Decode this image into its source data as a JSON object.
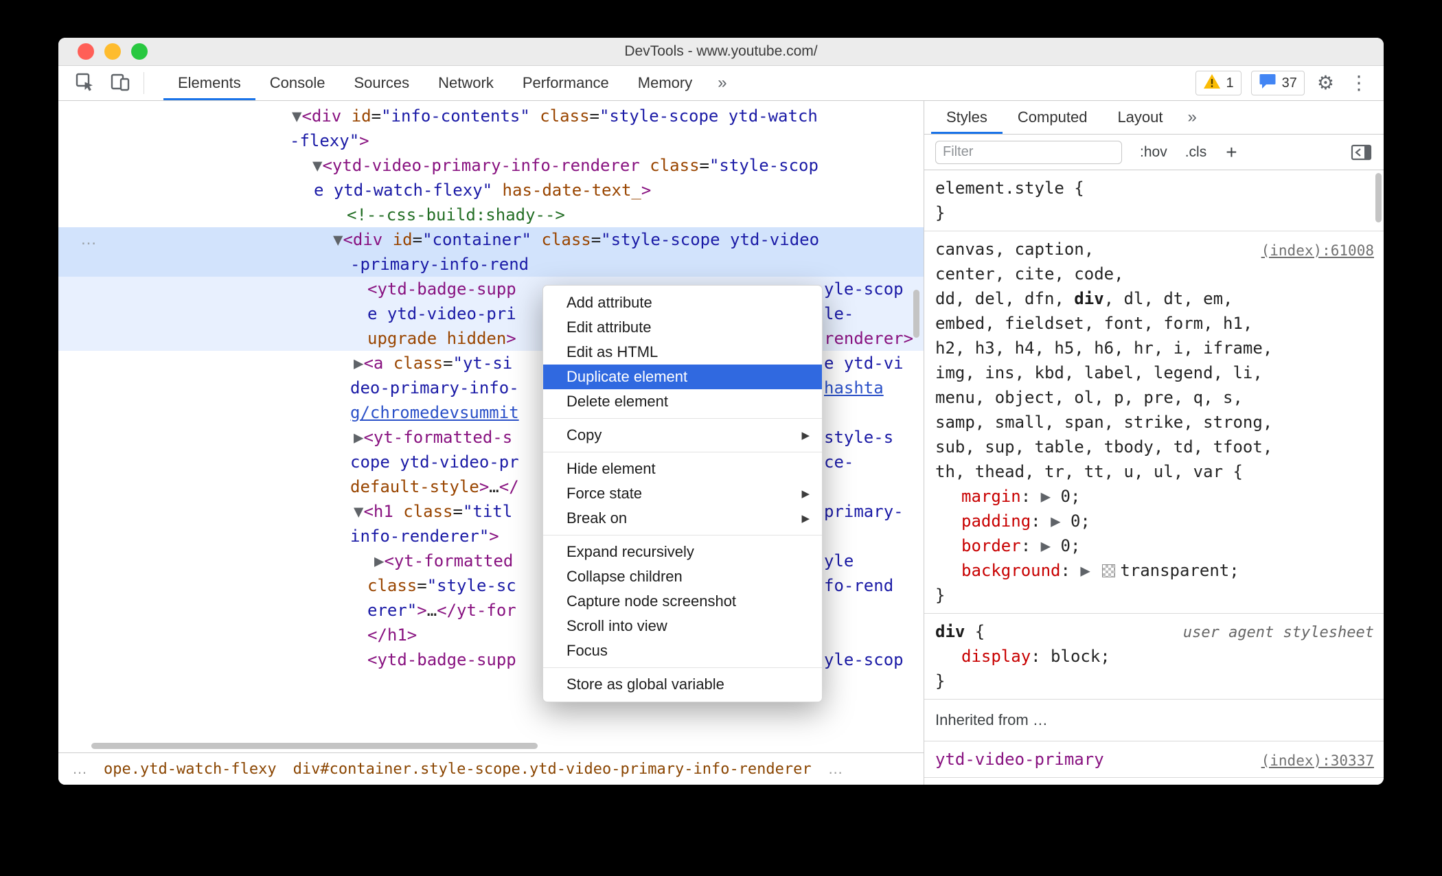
{
  "window": {
    "title": "DevTools - www.youtube.com/"
  },
  "icons": {
    "submenu_arrow": "▶",
    "gear": "⚙",
    "more_vertical": "⋮"
  },
  "colors": {
    "accent_blue": "#1a73e8",
    "menu_highlight": "#3069e0",
    "selection_blue": "#d2e3fc",
    "tag": "#881280",
    "attr_name": "#994500",
    "attr_value": "#1a1aa6",
    "property_red": "#c80000"
  },
  "toolbar": {
    "tabs": [
      {
        "label": "Elements",
        "selected": true
      },
      {
        "label": "Console",
        "selected": false
      },
      {
        "label": "Sources",
        "selected": false
      },
      {
        "label": "Network",
        "selected": false
      },
      {
        "label": "Performance",
        "selected": false
      },
      {
        "label": "Memory",
        "selected": false
      }
    ],
    "overflow_chevron": "»",
    "warning_count": "1",
    "message_count": "37"
  },
  "elements_panel": {
    "gutter_dots": "…",
    "tree_lines": [
      {
        "ind": 340,
        "se": [
          [
            "a",
            "▼"
          ],
          [
            "t",
            "<div "
          ],
          [
            "n",
            "id"
          ],
          [
            "p",
            "="
          ],
          [
            "v",
            "\"info-contents\""
          ],
          [
            "p",
            " "
          ],
          [
            "n",
            "class"
          ],
          [
            "p",
            "="
          ],
          [
            "v",
            "\"style-scope ytd-watch"
          ]
        ]
      },
      {
        "ind": 337,
        "se": [
          [
            "v",
            "-flexy\""
          ],
          [
            "t",
            ">"
          ]
        ]
      },
      {
        "ind": 370,
        "se": [
          [
            "a",
            "▼"
          ],
          [
            "t",
            "<ytd-video-primary-info-renderer "
          ],
          [
            "n",
            "class"
          ],
          [
            "p",
            "="
          ],
          [
            "v",
            "\"style-scop"
          ]
        ]
      },
      {
        "ind": 372,
        "se": [
          [
            "v",
            "e ytd-watch-flexy\" "
          ],
          [
            "n",
            "has-date-text_"
          ],
          [
            "t",
            ">"
          ]
        ]
      },
      {
        "ind": 420,
        "se": [
          [
            "c",
            "<!--css-build:shady-->"
          ]
        ]
      },
      {
        "ind": 400,
        "bg": "sel",
        "dots": true,
        "se": [
          [
            "a",
            "▼"
          ],
          [
            "t",
            "<div "
          ],
          [
            "n",
            "id"
          ],
          [
            "p",
            "="
          ],
          [
            "v",
            "\"container\""
          ],
          [
            "p",
            " "
          ],
          [
            "n",
            "class"
          ],
          [
            "p",
            "="
          ],
          [
            "v",
            "\"style-scope ytd-video"
          ]
        ]
      },
      {
        "ind": 425,
        "bg": "sel",
        "se": [
          [
            "v",
            "-primary-info-rend"
          ]
        ]
      },
      {
        "ind": 450,
        "bg": "pale",
        "se": [
          [
            "t",
            "<ytd-badge-supp"
          ]
        ],
        "right": [
          [
            "v",
            "yle-scop"
          ]
        ]
      },
      {
        "ind": 450,
        "bg": "pale",
        "se": [
          [
            "v",
            "e ytd-video-pri"
          ]
        ],
        "right": [
          [
            "v",
            "le-"
          ]
        ]
      },
      {
        "ind": 450,
        "bg": "pale",
        "se": [
          [
            "n",
            "upgrade hidden"
          ],
          [
            "t",
            ">"
          ]
        ],
        "right": [
          [
            "t",
            "renderer>"
          ]
        ]
      },
      {
        "ind": 430,
        "se": [
          [
            "a",
            "▶"
          ],
          [
            "t",
            "<a "
          ],
          [
            "n",
            "class"
          ],
          [
            "p",
            "="
          ],
          [
            "v",
            "\"yt-si"
          ]
        ],
        "right": [
          [
            "v",
            "e ytd-vi"
          ]
        ]
      },
      {
        "ind": 425,
        "se": [
          [
            "v",
            "deo-primary-info-"
          ]
        ],
        "right": [
          [
            "l",
            "hashta"
          ]
        ]
      },
      {
        "ind": 425,
        "se": [
          [
            "l",
            "g/chromedevsummit"
          ]
        ]
      },
      {
        "ind": 430,
        "se": [
          [
            "a",
            "▶"
          ],
          [
            "t",
            "<yt-formatted-s"
          ]
        ],
        "right": [
          [
            "v",
            "style-s"
          ]
        ]
      },
      {
        "ind": 425,
        "se": [
          [
            "v",
            "cope ytd-video-pr"
          ]
        ],
        "right": [
          [
            "v",
            "ce-"
          ]
        ]
      },
      {
        "ind": 425,
        "se": [
          [
            "n",
            "default-style"
          ],
          [
            "t",
            ">"
          ],
          [
            "p",
            "…"
          ],
          [
            "t",
            "</"
          ]
        ]
      },
      {
        "ind": 430,
        "se": [
          [
            "a",
            "▼"
          ],
          [
            "t",
            "<h1 "
          ],
          [
            "n",
            "class"
          ],
          [
            "p",
            "="
          ],
          [
            "v",
            "\"titl"
          ]
        ],
        "right": [
          [
            "v",
            "primary-"
          ]
        ]
      },
      {
        "ind": 425,
        "se": [
          [
            "v",
            "info-renderer\""
          ],
          [
            "t",
            ">"
          ]
        ]
      },
      {
        "ind": 460,
        "se": [
          [
            "a",
            "▶"
          ],
          [
            "t",
            "<yt-formatted"
          ]
        ],
        "right": [
          [
            "v",
            "yle"
          ]
        ]
      },
      {
        "ind": 450,
        "se": [
          [
            "n",
            "class"
          ],
          [
            "p",
            "="
          ],
          [
            "v",
            "\"style-sc"
          ]
        ],
        "right": [
          [
            "v",
            "fo-rend"
          ]
        ]
      },
      {
        "ind": 450,
        "se": [
          [
            "v",
            "erer\""
          ],
          [
            "t",
            ">"
          ],
          [
            "p",
            "…"
          ],
          [
            "t",
            "</yt-for"
          ]
        ]
      },
      {
        "ind": 450,
        "se": [
          [
            "t",
            "</h1>"
          ]
        ]
      },
      {
        "ind": 450,
        "se": [
          [
            "t",
            "<ytd-badge-supp"
          ]
        ],
        "right": [
          [
            "v",
            "yle-scop"
          ]
        ]
      }
    ],
    "breadcrumbs": {
      "leading_ellipsis": "…",
      "crumb1": "ope.ytd-watch-flexy",
      "crumb2": "div#container.style-scope.ytd-video-primary-info-renderer",
      "trailing_ellipsis": "…"
    }
  },
  "context_menu": {
    "items": [
      {
        "label": "Add attribute"
      },
      {
        "label": "Edit attribute"
      },
      {
        "label": "Edit as HTML"
      },
      {
        "label": "Duplicate element",
        "highlighted": true
      },
      {
        "label": "Delete element"
      },
      {
        "sep": true
      },
      {
        "label": "Copy",
        "submenu": true
      },
      {
        "sep": true
      },
      {
        "label": "Hide element"
      },
      {
        "label": "Force state",
        "submenu": true
      },
      {
        "label": "Break on",
        "submenu": true
      },
      {
        "sep": true
      },
      {
        "label": "Expand recursively"
      },
      {
        "label": "Collapse children"
      },
      {
        "label": "Capture node screenshot"
      },
      {
        "label": "Scroll into view"
      },
      {
        "label": "Focus"
      },
      {
        "sep": true
      },
      {
        "label": "Store as global variable"
      }
    ]
  },
  "styles_panel": {
    "tabs": [
      {
        "label": "Styles",
        "selected": true
      },
      {
        "label": "Computed",
        "selected": false
      },
      {
        "label": "Layout",
        "selected": false
      }
    ],
    "overflow_chevron": "»",
    "filter_placeholder": "Filter",
    "pseudo_button": ":hov",
    "class_button": ".cls",
    "add_button": "+",
    "sections": [
      {
        "lines": [
          {
            "ind": 0,
            "se": [
              [
                "p",
                "element.style {"
              ]
            ]
          },
          {
            "ind": 0,
            "se": [
              [
                "p",
                "}"
              ]
            ]
          }
        ]
      },
      {
        "link": "(index):61008",
        "lines": [
          {
            "ind": 0,
            "se": [
              [
                "p",
                "canvas, caption,"
              ]
            ]
          },
          {
            "ind": 0,
            "se": [
              [
                "p",
                "center, cite, code,"
              ]
            ]
          },
          {
            "ind": 0,
            "se": [
              [
                "p",
                "dd, del, dfn, "
              ],
              [
                "b",
                "div"
              ],
              [
                "p",
                ", dl, dt, em,"
              ]
            ]
          },
          {
            "ind": 0,
            "se": [
              [
                "p",
                "embed, fieldset, font, form, h1,"
              ]
            ]
          },
          {
            "ind": 0,
            "se": [
              [
                "p",
                "h2, h3, h4, h5, h6, hr, i, iframe,"
              ]
            ]
          },
          {
            "ind": 0,
            "se": [
              [
                "p",
                "img, ins, kbd, label, legend, li,"
              ]
            ]
          },
          {
            "ind": 0,
            "se": [
              [
                "p",
                "menu, object, ol, p, pre, q, s,"
              ]
            ]
          },
          {
            "ind": 0,
            "se": [
              [
                "p",
                "samp, small, span, strike, strong,"
              ]
            ]
          },
          {
            "ind": 0,
            "se": [
              [
                "p",
                "sub, sup, table, tbody, td, tfoot,"
              ]
            ]
          },
          {
            "ind": 0,
            "se": [
              [
                "p",
                "th, thead, tr, tt, u, ul, var {"
              ]
            ]
          },
          {
            "ind": 38,
            "se": [
              [
                "prop",
                "margin"
              ],
              [
                "p",
                ": "
              ],
              [
                "a",
                "▶"
              ],
              [
                "p",
                " 0;"
              ]
            ]
          },
          {
            "ind": 38,
            "se": [
              [
                "prop",
                "padding"
              ],
              [
                "p",
                ": "
              ],
              [
                "a",
                "▶"
              ],
              [
                "p",
                " 0;"
              ]
            ]
          },
          {
            "ind": 38,
            "se": [
              [
                "prop",
                "border"
              ],
              [
                "p",
                ": "
              ],
              [
                "a",
                "▶"
              ],
              [
                "p",
                " 0;"
              ]
            ]
          },
          {
            "ind": 38,
            "se": [
              [
                "prop",
                "background"
              ],
              [
                "p",
                ": "
              ],
              [
                "a",
                "▶"
              ],
              [
                "p",
                " "
              ],
              [
                "sw",
                ""
              ],
              [
                "p",
                "transparent;"
              ]
            ]
          },
          {
            "ind": 0,
            "se": [
              [
                "p",
                "}"
              ]
            ]
          }
        ]
      },
      {
        "link": "user agent stylesheet",
        "link_class": "ua",
        "lines": [
          {
            "ind": 0,
            "se": [
              [
                "b",
                "div"
              ],
              [
                "p",
                " {"
              ]
            ]
          },
          {
            "ind": 38,
            "se": [
              [
                "prop",
                "display"
              ],
              [
                "p",
                ": block;"
              ]
            ]
          },
          {
            "ind": 0,
            "se": [
              [
                "p",
                "}"
              ]
            ]
          }
        ]
      },
      {
        "header": "Inherited from …"
      },
      {
        "link": "(index):30337",
        "lines": [
          {
            "ind": 0,
            "se": [
              [
                "node",
                "ytd-video-primary"
              ]
            ]
          }
        ]
      }
    ]
  }
}
